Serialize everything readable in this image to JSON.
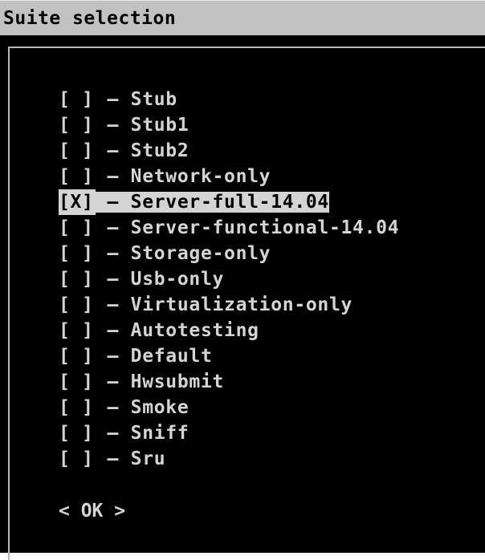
{
  "window": {
    "title": "Suite selection"
  },
  "suites": [
    {
      "mark": "[ ]",
      "sep": " – ",
      "name": "Stub",
      "selected": false
    },
    {
      "mark": "[ ]",
      "sep": " – ",
      "name": "Stub1",
      "selected": false
    },
    {
      "mark": "[ ]",
      "sep": " – ",
      "name": "Stub2",
      "selected": false
    },
    {
      "mark": "[ ]",
      "sep": " – ",
      "name": "Network-only",
      "selected": false
    },
    {
      "mark": "[X]",
      "sep": " – ",
      "name": "Server-full-14.04",
      "selected": true
    },
    {
      "mark": "[ ]",
      "sep": " – ",
      "name": "Server-functional-14.04",
      "selected": false
    },
    {
      "mark": "[ ]",
      "sep": " – ",
      "name": "Storage-only",
      "selected": false
    },
    {
      "mark": "[ ]",
      "sep": " – ",
      "name": "Usb-only",
      "selected": false
    },
    {
      "mark": "[ ]",
      "sep": " – ",
      "name": "Virtualization-only",
      "selected": false
    },
    {
      "mark": "[ ]",
      "sep": " – ",
      "name": "Autotesting",
      "selected": false
    },
    {
      "mark": "[ ]",
      "sep": " – ",
      "name": "Default",
      "selected": false
    },
    {
      "mark": "[ ]",
      "sep": " – ",
      "name": "Hwsubmit",
      "selected": false
    },
    {
      "mark": "[ ]",
      "sep": " – ",
      "name": "Smoke",
      "selected": false
    },
    {
      "mark": "[ ]",
      "sep": " – ",
      "name": "Sniff",
      "selected": false
    },
    {
      "mark": "[ ]",
      "sep": " – ",
      "name": "Sru",
      "selected": false
    }
  ],
  "buttons": {
    "ok_label": "< OK >"
  },
  "colors": {
    "title_bar": "#c2c2c2",
    "terminal_bg": "#000000",
    "text": "#d4d4d4",
    "highlight_bg": "#d4d4d4",
    "highlight_text": "#000000"
  }
}
